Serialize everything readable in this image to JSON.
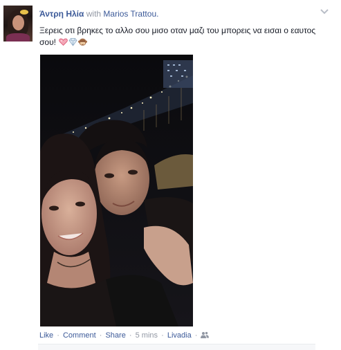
{
  "post": {
    "author": "Άντρη Ηλία",
    "with_text": "with",
    "tagged": "Marios Trattou.",
    "status_text": "Ξερεις οτι βρηκες το αλλο σου μισο οταν μαζι του μπορεις να εισαι ο εαυτος σου!",
    "emojis": [
      "heart-icon",
      "diamond-icon",
      "monkey-icon"
    ]
  },
  "footer": {
    "like": "Like",
    "comment": "Comment",
    "share": "Share",
    "time": "5 mins",
    "location": "Livadia",
    "separator": "·",
    "audience_icon": "friends-icon"
  },
  "colors": {
    "link": "#3b5998",
    "meta": "#9197a3",
    "text": "#141823"
  }
}
